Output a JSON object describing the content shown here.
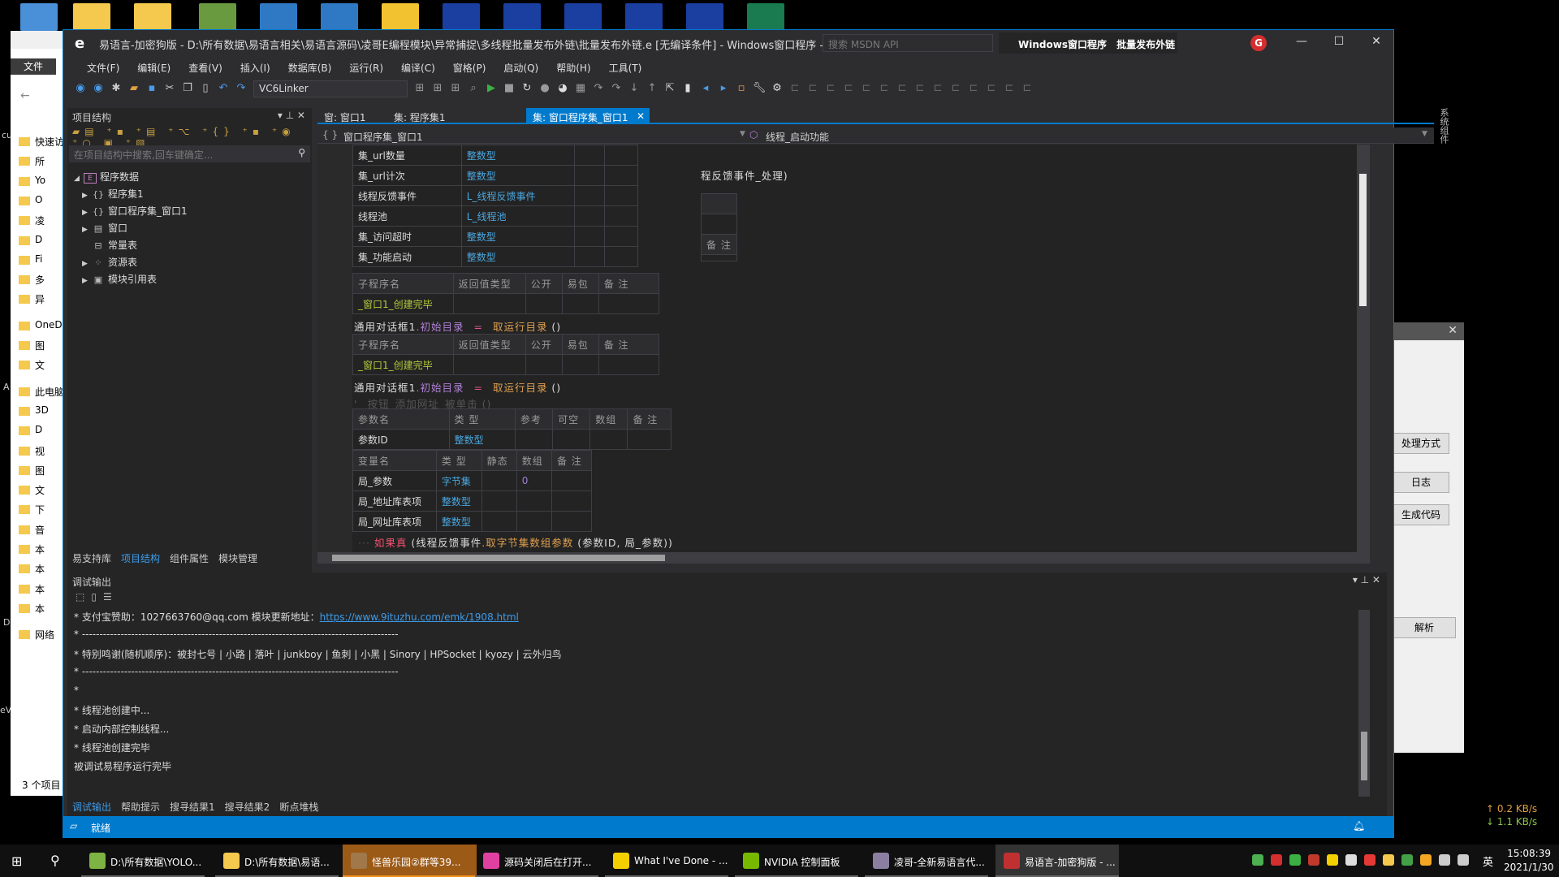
{
  "explorer": {
    "ribbon_tab": "文件",
    "nav_items": [
      "快速访问",
      "所",
      "Yo",
      "O",
      "凌",
      "D",
      "Fi",
      "多",
      "异",
      "OneDrive",
      "图",
      "文",
      "此电脑",
      "3D",
      "D",
      "视",
      "图",
      "文",
      "下",
      "音",
      "本",
      "本",
      "本",
      "本",
      "网络"
    ],
    "status": "3 个项目",
    "desktop_labels": [
      "cu",
      "A",
      "D",
      "eV"
    ]
  },
  "ide": {
    "title": "易语言-加密狗版  - D:\\所有数据\\易语言相关\\易语言源码\\凌哥E编程模块\\异常捕捉\\多线程批量发布外链\\批量发布外链.e [无编译条件] - Windows窗口程序 - [程...",
    "search_placeholder": "搜索 MSDN API",
    "solution_label": "Windows窗口程序  批量发布外链",
    "window_controls": {
      "minimize": "—",
      "maximize": "☐",
      "close": "✕"
    },
    "menu": [
      "文件(F)",
      "编辑(E)",
      "查看(V)",
      "插入(I)",
      "数据库(B)",
      "运行(R)",
      "编译(C)",
      "窗格(P)",
      "启动(Q)",
      "帮助(H)",
      "工具(T)"
    ],
    "linker": "VC6Linker",
    "left_panel": {
      "title": "项目结构",
      "search_placeholder": "在项目结构中搜索,回车键确定...",
      "tree": [
        {
          "label": "程序数据",
          "icon": "E",
          "expanded": true,
          "level": 0
        },
        {
          "label": "程序集1",
          "icon": "{}",
          "level": 1,
          "arrow": true
        },
        {
          "label": "窗口程序集_窗口1",
          "icon": "{}",
          "level": 1,
          "arrow": true
        },
        {
          "label": "窗口",
          "icon": "▤",
          "level": 1,
          "arrow": true
        },
        {
          "label": "常量表",
          "icon": "⊟",
          "level": 1,
          "arrow": false
        },
        {
          "label": "资源表",
          "icon": "⁘",
          "level": 1,
          "arrow": true
        },
        {
          "label": "模块引用表",
          "icon": "▣",
          "level": 1,
          "arrow": true
        }
      ],
      "tabs": [
        "易支持库",
        "项目结构",
        "组件属性",
        "模块管理"
      ],
      "active_tab": 1
    },
    "editor": {
      "tabs": [
        "窗: 窗口1",
        "集: 程序集1",
        "集: 窗口程序集_窗口1"
      ],
      "active_tab": 2,
      "left_combo": "窗口程序集_窗口1",
      "right_combo": "线程_启动功能",
      "side_strip": "系统组件",
      "globals": [
        [
          "集_url数量",
          "整数型"
        ],
        [
          "集_url计次",
          "整数型"
        ],
        [
          "线程反馈事件",
          "L_线程反馈事件"
        ],
        [
          "线程池",
          "L_线程池"
        ],
        [
          "集_访问超时",
          "整数型"
        ],
        [
          "集_功能启动",
          "整数型"
        ]
      ],
      "behind_line": "程反馈事件_处理)",
      "behind_header": "备 注",
      "sub_header": [
        "子程序名",
        "返回值类型",
        "公开",
        "易包",
        "备 注"
      ],
      "sub_name": "_窗口1_创建完毕",
      "line_assign": {
        "obj": "通用对话框1",
        "dot": ".",
        "prop": "初始目录",
        "eq": "=",
        "func": "取运行目录",
        "args": " ()"
      },
      "comment": "' _按钮_添加网址_被单击 ()",
      "param_header": [
        "参数名",
        "类 型",
        "参考",
        "可空",
        "数组",
        "备 注"
      ],
      "params": [
        [
          "参数ID",
          "整数型"
        ]
      ],
      "var_header": [
        "变量名",
        "类 型",
        "静态",
        "数组",
        "备 注"
      ],
      "vars": [
        [
          "局_参数",
          "字节集",
          "",
          "0"
        ],
        [
          "局_地址库表项",
          "整数型",
          "",
          ""
        ],
        [
          "局_网址库表项",
          "整数型",
          "",
          ""
        ]
      ],
      "if_line": {
        "kw": "如果真",
        "open": " (线程反馈事件",
        "dot": ".",
        "func": "取字节集数组参数",
        "args": " (参数ID, 局_参数))"
      }
    },
    "debug": {
      "title": "调试输出",
      "lines": [
        {
          "text": "* 支付宝赞助：1027663760@qq.com   模块更新地址：",
          "link": "https://www.9ituzhu.com/emk/1908.html"
        },
        {
          "text": "* ------------------------------------------------------------------------------------------"
        },
        {
          "text": "* 特别鸣谢(随机顺序)：被封七号 | 小路 | 落叶 | junkboy | 鱼刺 | 小黑 | Sinory | HPSocket | kyozy | 云外归鸟"
        },
        {
          "text": "* ------------------------------------------------------------------------------------------"
        },
        {
          "text": "*"
        },
        {
          "text": "* 线程池创建中..."
        },
        {
          "text": "* 启动内部控制线程..."
        },
        {
          "text": "* 线程池创建完毕"
        },
        {
          "text": "被调试易程序运行完毕"
        }
      ],
      "tabs": [
        "调试输出",
        "帮助提示",
        "搜寻结果1",
        "搜寻结果2",
        "断点堆栈"
      ],
      "active_tab": 0
    },
    "status": "就绪"
  },
  "dialog": {
    "buttons": [
      "处理方式",
      "日志",
      "生成代码",
      "解析"
    ]
  },
  "netspeed": {
    "up": "↑ 0.2 KB/s",
    "down": "↓ 1.1 KB/s",
    "up_color": "#e0a040",
    "down_color": "#8bc34a"
  },
  "taskbar": {
    "items": [
      {
        "label": "D:\\所有数据\\YOLO...",
        "color": "#7cb342"
      },
      {
        "label": "D:\\所有数据\\易语...",
        "color": "#f5c94d"
      },
      {
        "label": "怪兽乐园②群等39...",
        "color": "#a0784a",
        "state": "highlight"
      },
      {
        "label": "源码关闭后在打开...",
        "color": "#e040a0"
      },
      {
        "label": "What I've Done - ...",
        "color": "#f5d000"
      },
      {
        "label": "NVIDIA 控制面板",
        "color": "#76b900"
      },
      {
        "label": "凌哥-全新易语言代...",
        "color": "#8a7fa0"
      },
      {
        "label": "易语言-加密狗版 - ...",
        "color": "#c03030",
        "state": "active"
      }
    ],
    "ime": "英",
    "time": "15:08:39",
    "date": "2021/1/30"
  },
  "colors": {
    "accent": "#007acc",
    "type": "#4aa7e0",
    "sub": "#b5cc3a",
    "keyword": "#f0506e"
  }
}
